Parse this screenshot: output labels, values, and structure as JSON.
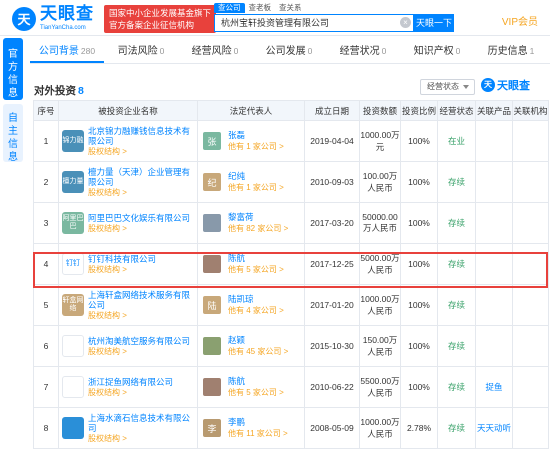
{
  "header": {
    "logo_mark": "天",
    "logo_name": "天眼查",
    "logo_sub": "TianYanCha.com",
    "banner_line1": "国家中小企业发展基金旗下",
    "banner_line2": "官方备案企业征信机构",
    "search_tabs": [
      "查公司",
      "查老板",
      "查关系"
    ],
    "search_value": "杭州宝轩投资管理有限公司",
    "search_button": "天眼一下",
    "vip": "VIP会员"
  },
  "side_tabs": [
    "官方信息",
    "自主信息"
  ],
  "tabs": [
    {
      "label": "公司背景",
      "count": "280"
    },
    {
      "label": "司法风险",
      "count": "0"
    },
    {
      "label": "经营风险",
      "count": "0"
    },
    {
      "label": "公司发展",
      "count": "0"
    },
    {
      "label": "经营状况",
      "count": "0"
    },
    {
      "label": "知识产权",
      "count": "0"
    },
    {
      "label": "历史信息",
      "count": "1"
    }
  ],
  "section": {
    "title": "对外投资",
    "count": "8",
    "filter": "经营状态",
    "watermark": "天眼查"
  },
  "columns": [
    "序号",
    "被投资企业名称",
    "法定代表人",
    "成立日期",
    "投资数额",
    "投资比例",
    "经营状态",
    "关联产品",
    "关联机构"
  ],
  "rows": [
    {
      "idx": "1",
      "logo": "锦力融",
      "logo_color": "#4a90b8",
      "company": "北京锦力融赚钱信息技术有限公司",
      "rel": "股权结构 >",
      "avatar": "张",
      "avatar_color": "#7ab8a0",
      "person": "张磊",
      "person_rel": "他有 1 家公司 >",
      "date": "2019-04-04",
      "amount": "1000.00万元",
      "ratio": "100%",
      "status": "在业",
      "product": "",
      "org": ""
    },
    {
      "idx": "2",
      "logo": "檀力量",
      "logo_color": "#4a90b8",
      "company": "檀力量（天津）企业管理有限公司",
      "rel": "股权结构 >",
      "avatar": "纪",
      "avatar_color": "#c8a87a",
      "person": "纪纯",
      "person_rel": "他有 1 家公司 >",
      "date": "2010-09-03",
      "amount": "100.00万人民币",
      "ratio": "100%",
      "status": "存续",
      "product": "",
      "org": ""
    },
    {
      "idx": "3",
      "logo": "阿里巴巴",
      "logo_color": "#7ab8a0",
      "company": "阿里巴巴文化娱乐有限公司",
      "rel": "股权结构 >",
      "avatar": "",
      "avatar_color": "#8899aa",
      "person": "黎富荷",
      "person_rel": "他有 82 家公司 >",
      "date": "2017-03-20",
      "amount": "50000.00万人民币",
      "ratio": "100%",
      "status": "存续",
      "product": "",
      "org": ""
    },
    {
      "idx": "4",
      "logo": "钉钉",
      "logo_color": "#ffffff",
      "company": "钉钉科技有限公司",
      "rel": "股权结构 >",
      "avatar": "",
      "avatar_color": "#a08070",
      "person": "陈航",
      "person_rel": "他有 5 家公司 >",
      "date": "2017-12-25",
      "amount": "5000.00万人民币",
      "ratio": "100%",
      "status": "存续",
      "product": "",
      "org": ""
    },
    {
      "idx": "5",
      "logo": "轩盒网络",
      "logo_color": "#c8a87a",
      "company": "上海轩盒网络技术服务有限公司",
      "rel": "股权结构 >",
      "avatar": "陆",
      "avatar_color": "#c8a87a",
      "person": "陆凯琼",
      "person_rel": "他有 4 家公司 >",
      "date": "2017-01-20",
      "amount": "1000.00万人民币",
      "ratio": "100%",
      "status": "存续",
      "product": "",
      "org": ""
    },
    {
      "idx": "6",
      "logo": "",
      "logo_color": "#ffffff",
      "company": "杭州淘美航空服务有限公司",
      "rel": "股权结构 >",
      "avatar": "",
      "avatar_color": "#8aa070",
      "person": "赵颖",
      "person_rel": "他有 45 家公司 >",
      "date": "2015-10-30",
      "amount": "150.00万人民币",
      "ratio": "100%",
      "status": "存续",
      "product": "",
      "org": ""
    },
    {
      "idx": "7",
      "logo": "",
      "logo_color": "#ffffff",
      "company": "浙江捉鱼网络有限公司",
      "rel": "股权结构 >",
      "avatar": "",
      "avatar_color": "#a08070",
      "person": "陈航",
      "person_rel": "他有 5 家公司 >",
      "date": "2010-06-22",
      "amount": "5500.00万人民币",
      "ratio": "100%",
      "status": "存续",
      "product": "捉鱼",
      "org": ""
    },
    {
      "idx": "8",
      "logo": "",
      "logo_color": "#2a8fd8",
      "company": "上海水滴石信息技术有限公司",
      "rel": "股权结构 >",
      "avatar": "李",
      "avatar_color": "#b89a70",
      "person": "李鹏",
      "person_rel": "他有 11 家公司 >",
      "date": "2008-05-09",
      "amount": "1000.00万人民币",
      "ratio": "2.78%",
      "status": "存续",
      "product": "天天动听",
      "org": ""
    }
  ]
}
